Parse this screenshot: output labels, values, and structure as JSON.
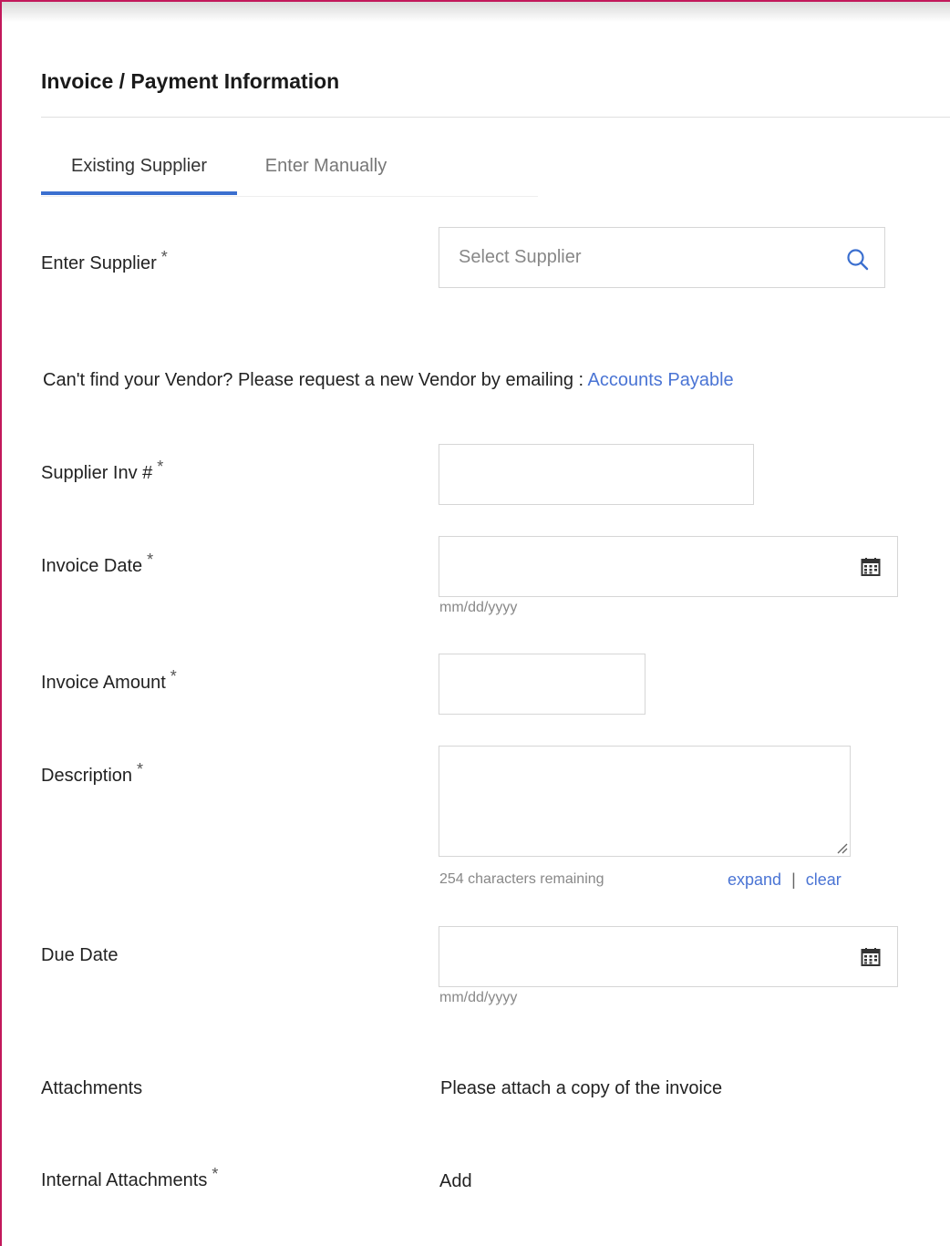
{
  "section": {
    "title": "Invoice / Payment Information"
  },
  "tabs": [
    {
      "label": "Existing Supplier",
      "active": true
    },
    {
      "label": "Enter Manually",
      "active": false
    }
  ],
  "required_marker": "*",
  "fields": {
    "supplier": {
      "label": "Enter Supplier",
      "placeholder": "Select Supplier",
      "value": ""
    },
    "vendor_help": {
      "text": "Can't find your Vendor? Please request a new Vendor by emailing : ",
      "link_label": "Accounts Payable"
    },
    "supplier_inv": {
      "label": "Supplier Inv #",
      "value": ""
    },
    "invoice_date": {
      "label": "Invoice Date",
      "value": "",
      "format_hint": "mm/dd/yyyy"
    },
    "invoice_amount": {
      "label": "Invoice Amount",
      "value": ""
    },
    "description": {
      "label": "Description",
      "value": "",
      "chars_remaining": "254 characters remaining",
      "expand_label": "expand",
      "separator": "|",
      "clear_label": "clear"
    },
    "due_date": {
      "label": "Due Date",
      "value": "",
      "format_hint": "mm/dd/yyyy"
    },
    "attachments": {
      "label": "Attachments",
      "text": "Please attach a copy of the invoice"
    },
    "internal_attachments": {
      "label": "Internal Attachments",
      "add_label": "Add"
    }
  },
  "colors": {
    "accent": "#3b6fcf",
    "link": "#4a74d4",
    "frame": "#c2185b"
  },
  "icons": [
    "search-icon",
    "calendar-icon",
    "resize-handle-icon"
  ]
}
